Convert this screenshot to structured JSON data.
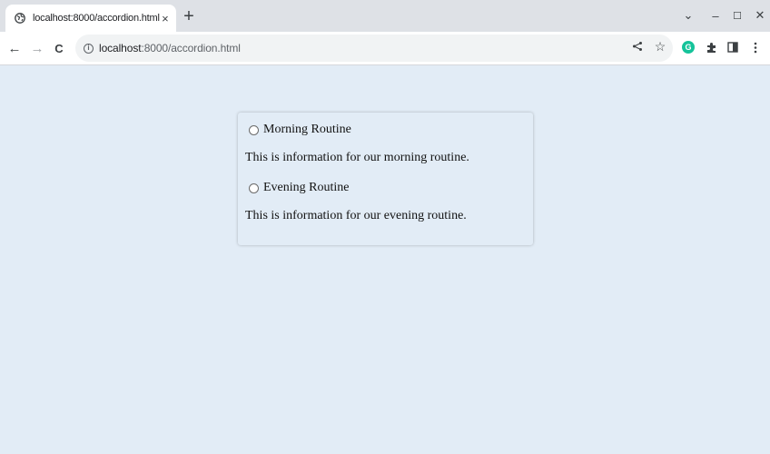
{
  "browser": {
    "tab_title": "localhost:8000/accordion.html",
    "tab_close": "×",
    "new_tab": "+",
    "window_controls": {
      "tab_search": "⌄",
      "minimize": "–",
      "maximize": "☐",
      "close": "✕"
    },
    "nav": {
      "back": "←",
      "forward": "→",
      "reload": "C"
    },
    "omnibox": {
      "info_icon": "i",
      "host": "localhost",
      "path": ":8000/accordion.html"
    },
    "toolbar_icons": [
      "share-icon",
      "bookmark-star-icon",
      "grammarly-icon",
      "extensions-icon",
      "side-panel-icon",
      "menu-icon"
    ],
    "grammarly_letter": "G"
  },
  "accordion": {
    "items": [
      {
        "title": "Morning Routine",
        "content": "This is information for our morning routine."
      },
      {
        "title": "Evening Routine",
        "content": "This is information for our evening routine."
      }
    ]
  },
  "colors": {
    "page_background": "#e2ecf6",
    "tabstrip": "#dee1e6",
    "grammarly": "#15c39a"
  }
}
